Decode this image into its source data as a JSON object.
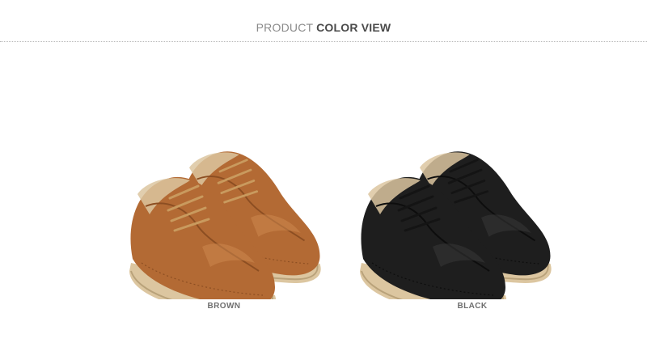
{
  "header": {
    "title_light": "PRODUCT",
    "title_bold": "COLOR VIEW"
  },
  "products": [
    {
      "color_name": "BROWN",
      "upper": "#b36a34",
      "shade": "#8c4e22",
      "highlight": "#d08a4f",
      "lace": "#c99a5e",
      "sole": "#dcc6a0"
    },
    {
      "color_name": "BLACK",
      "upper": "#1e1e1e",
      "shade": "#0d0d0d",
      "highlight": "#3a3a3a",
      "lace": "#141414",
      "sole": "#dcc6a0"
    }
  ],
  "colors": {
    "title_light": "#8a8a8a",
    "title_bold": "#4a4a4a",
    "label": "#6f6f6f",
    "divider": "#b5b5b5"
  }
}
